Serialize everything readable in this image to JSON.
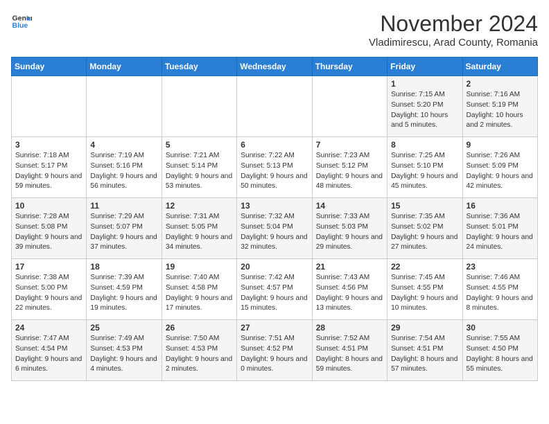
{
  "logo": {
    "line1": "General",
    "line2": "Blue"
  },
  "title": "November 2024",
  "subtitle": "Vladimirescu, Arad County, Romania",
  "days_of_week": [
    "Sunday",
    "Monday",
    "Tuesday",
    "Wednesday",
    "Thursday",
    "Friday",
    "Saturday"
  ],
  "weeks": [
    [
      {
        "day": "",
        "info": ""
      },
      {
        "day": "",
        "info": ""
      },
      {
        "day": "",
        "info": ""
      },
      {
        "day": "",
        "info": ""
      },
      {
        "day": "",
        "info": ""
      },
      {
        "day": "1",
        "info": "Sunrise: 7:15 AM\nSunset: 5:20 PM\nDaylight: 10 hours and 5 minutes."
      },
      {
        "day": "2",
        "info": "Sunrise: 7:16 AM\nSunset: 5:19 PM\nDaylight: 10 hours and 2 minutes."
      }
    ],
    [
      {
        "day": "3",
        "info": "Sunrise: 7:18 AM\nSunset: 5:17 PM\nDaylight: 9 hours and 59 minutes."
      },
      {
        "day": "4",
        "info": "Sunrise: 7:19 AM\nSunset: 5:16 PM\nDaylight: 9 hours and 56 minutes."
      },
      {
        "day": "5",
        "info": "Sunrise: 7:21 AM\nSunset: 5:14 PM\nDaylight: 9 hours and 53 minutes."
      },
      {
        "day": "6",
        "info": "Sunrise: 7:22 AM\nSunset: 5:13 PM\nDaylight: 9 hours and 50 minutes."
      },
      {
        "day": "7",
        "info": "Sunrise: 7:23 AM\nSunset: 5:12 PM\nDaylight: 9 hours and 48 minutes."
      },
      {
        "day": "8",
        "info": "Sunrise: 7:25 AM\nSunset: 5:10 PM\nDaylight: 9 hours and 45 minutes."
      },
      {
        "day": "9",
        "info": "Sunrise: 7:26 AM\nSunset: 5:09 PM\nDaylight: 9 hours and 42 minutes."
      }
    ],
    [
      {
        "day": "10",
        "info": "Sunrise: 7:28 AM\nSunset: 5:08 PM\nDaylight: 9 hours and 39 minutes."
      },
      {
        "day": "11",
        "info": "Sunrise: 7:29 AM\nSunset: 5:07 PM\nDaylight: 9 hours and 37 minutes."
      },
      {
        "day": "12",
        "info": "Sunrise: 7:31 AM\nSunset: 5:05 PM\nDaylight: 9 hours and 34 minutes."
      },
      {
        "day": "13",
        "info": "Sunrise: 7:32 AM\nSunset: 5:04 PM\nDaylight: 9 hours and 32 minutes."
      },
      {
        "day": "14",
        "info": "Sunrise: 7:33 AM\nSunset: 5:03 PM\nDaylight: 9 hours and 29 minutes."
      },
      {
        "day": "15",
        "info": "Sunrise: 7:35 AM\nSunset: 5:02 PM\nDaylight: 9 hours and 27 minutes."
      },
      {
        "day": "16",
        "info": "Sunrise: 7:36 AM\nSunset: 5:01 PM\nDaylight: 9 hours and 24 minutes."
      }
    ],
    [
      {
        "day": "17",
        "info": "Sunrise: 7:38 AM\nSunset: 5:00 PM\nDaylight: 9 hours and 22 minutes."
      },
      {
        "day": "18",
        "info": "Sunrise: 7:39 AM\nSunset: 4:59 PM\nDaylight: 9 hours and 19 minutes."
      },
      {
        "day": "19",
        "info": "Sunrise: 7:40 AM\nSunset: 4:58 PM\nDaylight: 9 hours and 17 minutes."
      },
      {
        "day": "20",
        "info": "Sunrise: 7:42 AM\nSunset: 4:57 PM\nDaylight: 9 hours and 15 minutes."
      },
      {
        "day": "21",
        "info": "Sunrise: 7:43 AM\nSunset: 4:56 PM\nDaylight: 9 hours and 13 minutes."
      },
      {
        "day": "22",
        "info": "Sunrise: 7:45 AM\nSunset: 4:55 PM\nDaylight: 9 hours and 10 minutes."
      },
      {
        "day": "23",
        "info": "Sunrise: 7:46 AM\nSunset: 4:55 PM\nDaylight: 9 hours and 8 minutes."
      }
    ],
    [
      {
        "day": "24",
        "info": "Sunrise: 7:47 AM\nSunset: 4:54 PM\nDaylight: 9 hours and 6 minutes."
      },
      {
        "day": "25",
        "info": "Sunrise: 7:49 AM\nSunset: 4:53 PM\nDaylight: 9 hours and 4 minutes."
      },
      {
        "day": "26",
        "info": "Sunrise: 7:50 AM\nSunset: 4:53 PM\nDaylight: 9 hours and 2 minutes."
      },
      {
        "day": "27",
        "info": "Sunrise: 7:51 AM\nSunset: 4:52 PM\nDaylight: 9 hours and 0 minutes."
      },
      {
        "day": "28",
        "info": "Sunrise: 7:52 AM\nSunset: 4:51 PM\nDaylight: 8 hours and 59 minutes."
      },
      {
        "day": "29",
        "info": "Sunrise: 7:54 AM\nSunset: 4:51 PM\nDaylight: 8 hours and 57 minutes."
      },
      {
        "day": "30",
        "info": "Sunrise: 7:55 AM\nSunset: 4:50 PM\nDaylight: 8 hours and 55 minutes."
      }
    ]
  ]
}
